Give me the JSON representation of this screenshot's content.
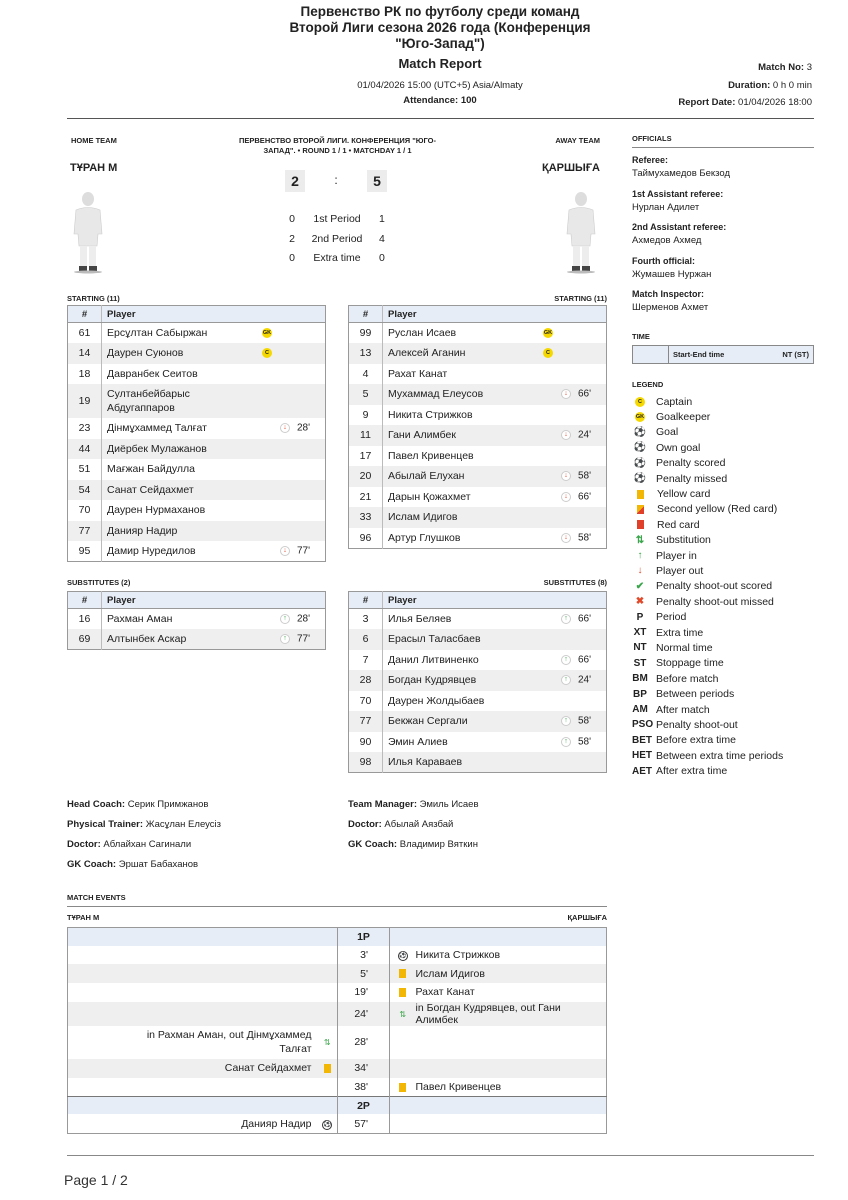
{
  "header": {
    "title_line1": "Первенство РК по футболу среди команд",
    "title_line2": "Второй Лиги сезона 2026 года (Конференция",
    "title_line3": "\"Юго-Запад\")",
    "report_label": "Match Report",
    "datetime": "01/04/2026 15:00 (UTC+5) Asia/Almaty",
    "attendance_label": "Attendance:",
    "attendance_value": "100",
    "match_no_label": "Match No:",
    "match_no_value": "3",
    "duration_label": "Duration:",
    "duration_value": "0 h 0 min",
    "report_date_label": "Report Date:",
    "report_date_value": "01/04/2026 18:00"
  },
  "match": {
    "home_label": "HOME TEAM",
    "away_label": "AWAY TEAM",
    "competition_line1": "ПЕРВЕНСТВО ВТОРОЙ ЛИГИ. КОНФЕРЕНЦИЯ \"ЮГО-",
    "competition_line2": "ЗАПАД\". • ROUND 1 / 1 • MATCHDAY 1 / 1",
    "home_team": "ТҰРАН М",
    "away_team": "ҚАРШЫҒА",
    "home_score": "2",
    "away_score": "5",
    "separator": ":",
    "periods": [
      {
        "home": "0",
        "label": "1st Period",
        "away": "1"
      },
      {
        "home": "2",
        "label": "2nd Period",
        "away": "4"
      },
      {
        "home": "0",
        "label": "Extra time",
        "away": "0"
      }
    ]
  },
  "lineups": {
    "starting_home_label": "STARTING (11)",
    "starting_away_label": "STARTING (11)",
    "subs_home_label": "SUBSTITUTES (2)",
    "subs_away_label": "SUBSTITUTES (8)",
    "col_num": "#",
    "col_player": "Player",
    "home_starting": [
      {
        "num": "61",
        "name": "Ерсұлтан Сабыржан",
        "badge": "GK"
      },
      {
        "num": "14",
        "name": "Даурен Суюнов",
        "badge": "C"
      },
      {
        "num": "18",
        "name": "Давранбек Сеитов"
      },
      {
        "num": "19",
        "name1": "Султанбейбарыс",
        "name2": "Абдугаппаров"
      },
      {
        "num": "23",
        "name": "Дінмұхаммед Талғат",
        "sub": "out",
        "minute": "28'"
      },
      {
        "num": "44",
        "name": "Диёрбек Мулажанов"
      },
      {
        "num": "51",
        "name": "Мағжан Байдулла"
      },
      {
        "num": "54",
        "name": "Санат Сейдахмет"
      },
      {
        "num": "70",
        "name": "Даурен Нурмаханов"
      },
      {
        "num": "77",
        "name": "Данияр Надир"
      },
      {
        "num": "95",
        "name": "Дамир Нуредилов",
        "sub": "out",
        "minute": "77'"
      }
    ],
    "away_starting": [
      {
        "num": "99",
        "name": "Руслан Исаев",
        "badge": "GK"
      },
      {
        "num": "13",
        "name": "Алексей Аганин",
        "badge": "C"
      },
      {
        "num": "4",
        "name": "Рахат Канат"
      },
      {
        "num": "5",
        "name": "Мухаммад Елеусов",
        "sub": "out",
        "minute": "66'"
      },
      {
        "num": "9",
        "name": "Никита Стрижков"
      },
      {
        "num": "11",
        "name": "Гани Алимбек",
        "sub": "out",
        "minute": "24'"
      },
      {
        "num": "17",
        "name": "Павел Кривенцев"
      },
      {
        "num": "20",
        "name": "Абылай Елухан",
        "sub": "out",
        "minute": "58'"
      },
      {
        "num": "21",
        "name": "Дарын Қожахмет",
        "sub": "out",
        "minute": "66'"
      },
      {
        "num": "33",
        "name": "Ислам Идигов"
      },
      {
        "num": "96",
        "name": "Артур Глушков",
        "sub": "out",
        "minute": "58'"
      }
    ],
    "home_subs": [
      {
        "num": "16",
        "name": "Рахман Аман",
        "sub": "in",
        "minute": "28'"
      },
      {
        "num": "69",
        "name": "Алтынбек Аскар",
        "sub": "in",
        "minute": "77'"
      }
    ],
    "away_subs": [
      {
        "num": "3",
        "name": "Илья Беляев",
        "sub": "in",
        "minute": "66'"
      },
      {
        "num": "6",
        "name": "Ерасыл Таласбаев"
      },
      {
        "num": "7",
        "name": "Данил Литвиненко",
        "sub": "in",
        "minute": "66'"
      },
      {
        "num": "28",
        "name": "Богдан Кудрявцев",
        "sub": "in",
        "minute": "24'"
      },
      {
        "num": "70",
        "name": "Даурен Жолдыбаев"
      },
      {
        "num": "77",
        "name": "Бекжан Сергали",
        "sub": "in",
        "minute": "58'"
      },
      {
        "num": "90",
        "name": "Эмин Алиев",
        "sub": "in",
        "minute": "58'"
      },
      {
        "num": "98",
        "name": "Илья Караваев"
      }
    ]
  },
  "officials": {
    "heading": "OFFICIALS",
    "items": [
      {
        "label": "Referee:",
        "value": "Таймухамедов Бекзод"
      },
      {
        "label": "1st Assistant referee:",
        "value": "Нурлан Адилет"
      },
      {
        "label": "2nd Assistant referee:",
        "value": "Ахмедов Ахмед"
      },
      {
        "label": "Fourth official:",
        "value": "Жумашев Нуржан"
      },
      {
        "label": "Match Inspector:",
        "value": "Шерменов Ахмет"
      }
    ]
  },
  "time": {
    "heading": "TIME",
    "col1": "Start-End time",
    "col2": "NT (ST)"
  },
  "legend": {
    "heading": "LEGEND",
    "items": [
      {
        "sym": "C",
        "kind": "badge",
        "label": "Captain"
      },
      {
        "sym": "GK",
        "kind": "badge",
        "label": "Goalkeeper"
      },
      {
        "sym": "⚽",
        "kind": "icon",
        "label": "Goal"
      },
      {
        "sym": "⚽",
        "kind": "own",
        "label": "Own goal"
      },
      {
        "sym": "⚽",
        "kind": "pen",
        "label": "Penalty scored"
      },
      {
        "sym": "⚽",
        "kind": "penmiss",
        "label": "Penalty missed"
      },
      {
        "sym": "",
        "kind": "yellow",
        "label": "Yellow card"
      },
      {
        "sym": "",
        "kind": "second",
        "label": "Second yellow (Red card)"
      },
      {
        "sym": "",
        "kind": "red",
        "label": "Red card"
      },
      {
        "sym": "⇅",
        "kind": "subst",
        "label": "Substitution"
      },
      {
        "sym": "↑",
        "kind": "in",
        "label": "Player in"
      },
      {
        "sym": "↓",
        "kind": "out",
        "label": "Player out"
      },
      {
        "sym": "✔",
        "kind": "check",
        "label": "Penalty shoot-out scored"
      },
      {
        "sym": "✖",
        "kind": "cross",
        "label": "Penalty shoot-out missed"
      },
      {
        "sym": "P",
        "kind": "text",
        "label": "Period"
      },
      {
        "sym": "XT",
        "kind": "text",
        "label": "Extra time"
      },
      {
        "sym": "NT",
        "kind": "text",
        "label": "Normal time"
      },
      {
        "sym": "ST",
        "kind": "text",
        "label": "Stoppage time"
      },
      {
        "sym": "BM",
        "kind": "text",
        "label": "Before match"
      },
      {
        "sym": "BP",
        "kind": "text",
        "label": "Between periods"
      },
      {
        "sym": "AM",
        "kind": "text",
        "label": "After match"
      },
      {
        "sym": "PSO",
        "kind": "text",
        "label": "Penalty shoot-out"
      },
      {
        "sym": "BET",
        "kind": "text",
        "label": "Before extra time"
      },
      {
        "sym": "HET",
        "kind": "text",
        "label": "Between extra time periods"
      },
      {
        "sym": "AET",
        "kind": "text",
        "label": "After extra time"
      }
    ]
  },
  "staff": {
    "home": [
      {
        "label": "Head Coach:",
        "value": "Серик Примжанов"
      },
      {
        "label": "Physical Trainer:",
        "value": "Жасұлан Елеусіз"
      },
      {
        "label": "Doctor:",
        "value": "Аблайхан Сагинали"
      },
      {
        "label": "GK Coach:",
        "value": "Эршат Бабаханов"
      }
    ],
    "away": [
      {
        "label": "Team Manager:",
        "value": "Эмиль Исаев"
      },
      {
        "label": "Doctor:",
        "value": "Абылай Аязбай"
      },
      {
        "label": "GK Coach:",
        "value": "Владимир Вяткин"
      }
    ]
  },
  "events": {
    "heading": "MATCH EVENTS",
    "home_team": "ТҰРАН М",
    "away_team": "ҚАРШЫҒА",
    "rows": [
      {
        "type": "period",
        "label": "1P"
      },
      {
        "minute": "3'",
        "side": "away",
        "icon": "goal",
        "text": "Никита Стрижков"
      },
      {
        "minute": "5'",
        "side": "away",
        "icon": "yellow",
        "text": "Ислам Идигов"
      },
      {
        "minute": "19'",
        "side": "away",
        "icon": "yellow",
        "text": "Рахат Канат"
      },
      {
        "minute": "24'",
        "side": "away",
        "icon": "subst",
        "text": "in Богдан Кудрявцев, out Гани Алимбек"
      },
      {
        "minute": "28'",
        "side": "home",
        "icon": "subst",
        "text1": "in Рахман Аман, out Дінмұхаммед",
        "text2": "Талғат"
      },
      {
        "minute": "34'",
        "side": "home",
        "icon": "yellow",
        "text": "Санат Сейдахмет"
      },
      {
        "minute": "38'",
        "side": "away",
        "icon": "yellow",
        "text": "Павел Кривенцев"
      },
      {
        "type": "period",
        "label": "2P"
      },
      {
        "minute": "57'",
        "side": "home",
        "icon": "goal",
        "text": "Данияр Надир"
      }
    ]
  },
  "footer": {
    "page": "Page 1 / 2"
  },
  "colors": {
    "table_header": "#e6edf6",
    "row_alt": "#efefef",
    "badge_yellow": "#f5d800",
    "sub_in": "#3aa54a",
    "sub_out": "#e04a2b"
  }
}
